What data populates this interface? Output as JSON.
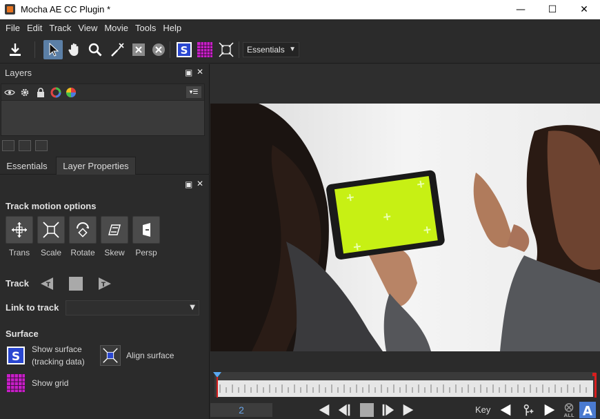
{
  "window": {
    "title": "Mocha AE CC Plugin *",
    "minimize": "—",
    "maximize": "☐",
    "close": "✕"
  },
  "menu": [
    "File",
    "Edit",
    "Track",
    "View",
    "Movie",
    "Tools",
    "Help"
  ],
  "toolbar": {
    "workspace_select": "Essentials",
    "tools": [
      "save-icon",
      "select-arrow-icon",
      "hand-icon",
      "zoom-icon",
      "add-x-spline-icon",
      "x-spline-icon",
      "delete-point-icon",
      "show-surface-icon",
      "show-grid-icon",
      "align-surface-icon"
    ]
  },
  "layers_panel": {
    "title": "Layers",
    "float_btn": "▣",
    "close_btn": "✕",
    "menu_btn": "▾☰"
  },
  "tabs": [
    {
      "label": "Essentials",
      "active": false
    },
    {
      "label": "Layer Properties",
      "active": true
    }
  ],
  "essentials": {
    "track_motion_title": "Track motion options",
    "motion_options": [
      "Trans",
      "Scale",
      "Rotate",
      "Skew",
      "Persp"
    ],
    "track_label": "Track",
    "link_to_track_label": "Link to track",
    "link_to_track_value": "",
    "surface_title": "Surface",
    "show_surface_label_line1": "Show surface",
    "show_surface_label_line2": "(tracking data)",
    "align_surface_label": "Align surface",
    "show_grid_label": "Show grid"
  },
  "timeline": {
    "current_frame": "2",
    "key_label": "Key",
    "all_label": "ALL"
  },
  "colors": {
    "accent_blue": "#5b7fa6",
    "surface_blue": "#2a47d0",
    "grid_magenta": "#c81ec8",
    "playhead_blue": "#5aa8f0",
    "out_point_red": "#d81e1e",
    "screen_green": "#c7f014"
  }
}
